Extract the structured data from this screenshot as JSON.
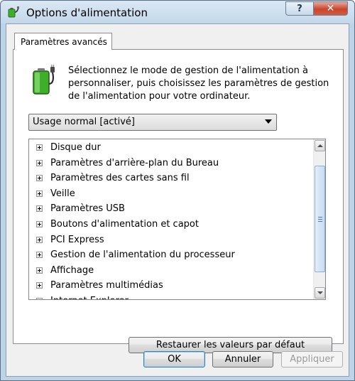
{
  "window": {
    "title": "Options d'alimentation",
    "help_label": "?",
    "close_label": "✕"
  },
  "tab": {
    "label": "Paramètres avancés"
  },
  "description": "Sélectionnez le mode de gestion de l'alimentation à personnaliser, puis choisissez les paramètres de gestion de l'alimentation pour votre ordinateur.",
  "plan_select": {
    "selected": "Usage normal [activé]"
  },
  "settings_tree": {
    "items": [
      {
        "label": "Disque dur"
      },
      {
        "label": "Paramètres d'arrière-plan du Bureau"
      },
      {
        "label": "Paramètres des cartes sans fil"
      },
      {
        "label": "Veille"
      },
      {
        "label": "Paramètres USB"
      },
      {
        "label": "Boutons d'alimentation et capot"
      },
      {
        "label": "PCI Express"
      },
      {
        "label": "Gestion de l'alimentation du processeur"
      },
      {
        "label": "Affichage"
      },
      {
        "label": "Paramètres multimédias"
      },
      {
        "label": "Internet Explorer"
      }
    ]
  },
  "buttons": {
    "restore": "Restaurer les valeurs par défaut",
    "ok": "OK",
    "cancel": "Annuler",
    "apply": "Appliquer"
  },
  "icons": {
    "title": "power-options-icon",
    "battery": "battery-plug-icon",
    "expander": "plus-expander-icon"
  },
  "colors": {
    "accent": "#3c7fb1",
    "close_button": "#c9452d",
    "battery_green": "#3fae2a"
  }
}
